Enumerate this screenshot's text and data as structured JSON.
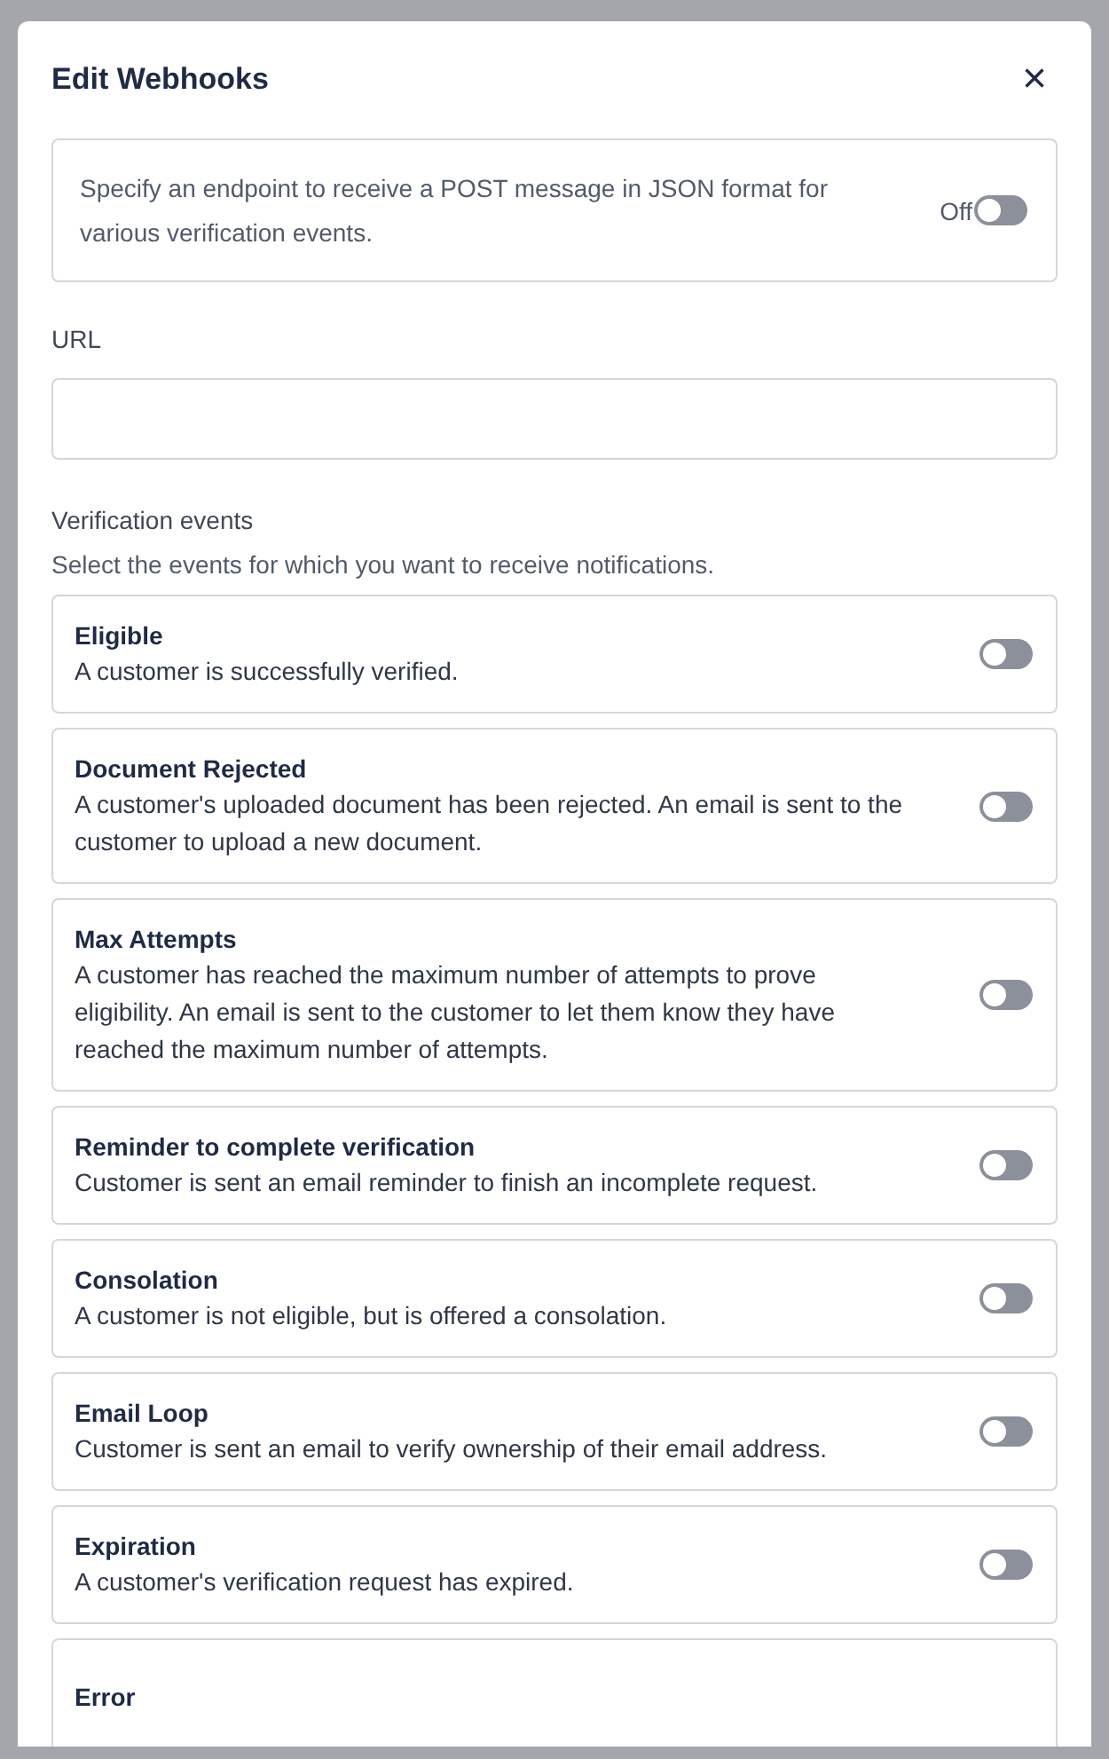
{
  "dialog": {
    "title": "Edit Webhooks",
    "close": "×"
  },
  "intro": {
    "text": "Specify an endpoint to receive a POST message in JSON format for various verification events.",
    "toggle_label": "Off",
    "on": false
  },
  "url": {
    "label": "URL"
  },
  "events_section": {
    "title": "Verification events",
    "hint": "Select the events for which you want to receive notifications."
  },
  "events": [
    {
      "title": "Eligible",
      "description": "A customer is successfully verified.",
      "on": false
    },
    {
      "title": "Document Rejected",
      "description": "A customer's uploaded document has been rejected. An email is sent to the customer to upload a new document.",
      "on": false
    },
    {
      "title": "Max Attempts",
      "description": "A customer has reached the maximum number of attempts to prove eligibility. An email is sent to the customer to let them know they have reached the maximum number of attempts.",
      "on": false
    },
    {
      "title": "Reminder to complete verification",
      "description": "Customer is sent an email reminder to finish an incomplete request.",
      "on": false
    },
    {
      "title": "Consolation",
      "description": "A customer is not eligible, but is offered a consolation.",
      "on": false
    },
    {
      "title": "Email Loop",
      "description": "Customer is sent an email to verify ownership of their email address.",
      "on": false
    },
    {
      "title": "Expiration",
      "description": "A customer's verification request has expired.",
      "on": false
    },
    {
      "title": "Error"
    }
  ]
}
